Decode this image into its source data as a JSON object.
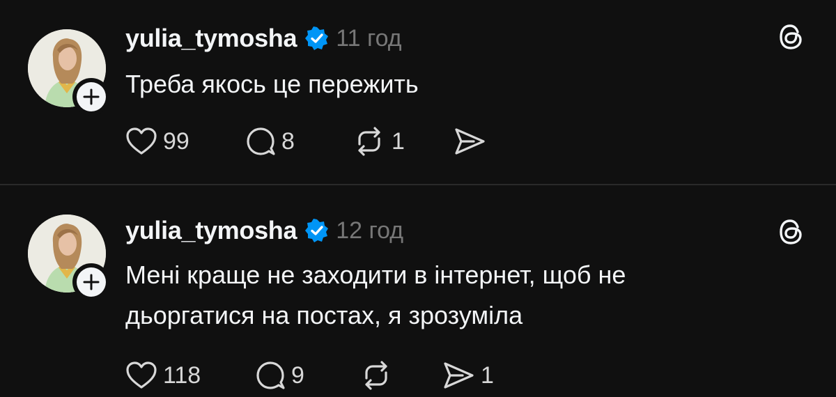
{
  "posts": [
    {
      "username": "yulia_tymosha",
      "timestamp": "11 год",
      "text_lines": [
        "Треба якось це пережить"
      ],
      "likes": "99",
      "replies": "8",
      "reposts": "1",
      "shares": ""
    },
    {
      "username": "yulia_tymosha",
      "timestamp": "12 год",
      "text_lines": [
        "Мені краще не заходити в інтернет, щоб не",
        "дьоргатися на постах, я зрозуміла"
      ],
      "likes": "118",
      "replies": "9",
      "reposts": "",
      "shares": "1"
    }
  ],
  "icons": {
    "like": "heart-icon",
    "reply": "reply-bubble-icon",
    "repost": "repost-icon",
    "share": "share-send-icon",
    "verified": "verified-badge-icon",
    "follow": "plus-icon",
    "app": "threads-logo-icon"
  },
  "colors": {
    "background": "#101010",
    "text": "#f3f5f7",
    "muted": "#777777",
    "verified": "#0095f6",
    "divider": "#2a2a2a"
  }
}
